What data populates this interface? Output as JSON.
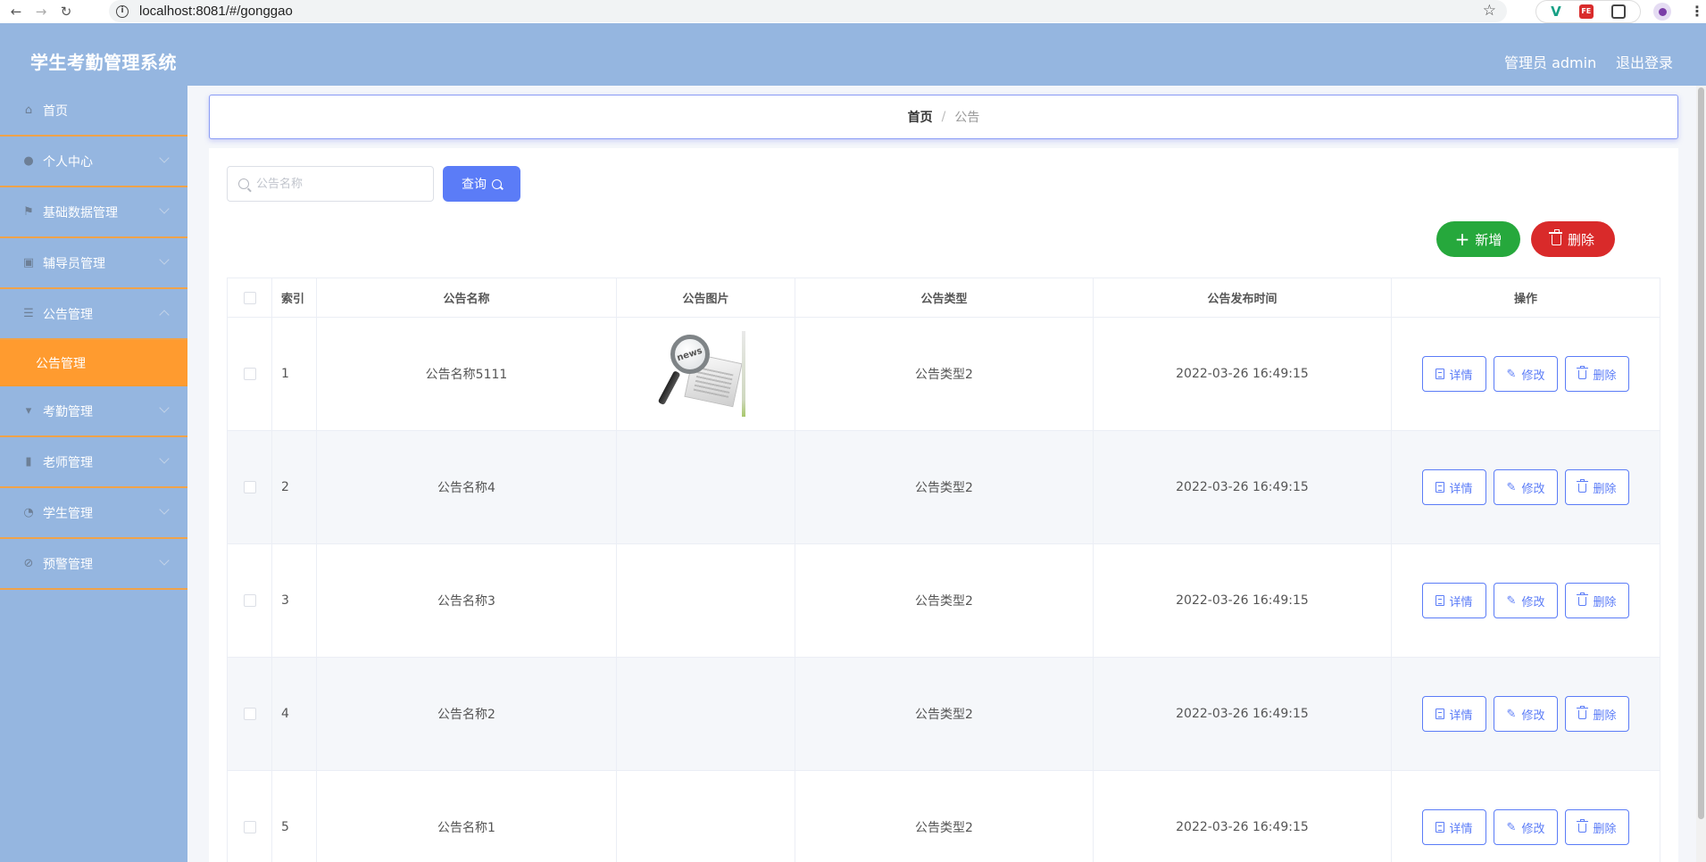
{
  "browser": {
    "url": "localhost:8081/#/gonggao"
  },
  "header": {
    "title": "学生考勤管理系统",
    "user": "管理员 admin",
    "logout": "退出登录"
  },
  "sidebar": {
    "items": [
      {
        "label": "首页",
        "icon": "home-icon"
      },
      {
        "label": "个人中心",
        "icon": "user-icon"
      },
      {
        "label": "基础数据管理",
        "icon": "flag-icon"
      },
      {
        "label": "辅导员管理",
        "icon": "chart-icon"
      },
      {
        "label": "公告管理",
        "icon": "menu-icon"
      },
      {
        "label": "考勤管理",
        "icon": "brush-icon"
      },
      {
        "label": "老师管理",
        "icon": "bar-chart-icon"
      },
      {
        "label": "学生管理",
        "icon": "gauge-icon"
      },
      {
        "label": "预警管理",
        "icon": "bell-off-icon"
      }
    ],
    "active_sub": "公告管理"
  },
  "breadcrumb": {
    "home": "首页",
    "sep": "/",
    "current": "公告"
  },
  "search": {
    "placeholder": "公告名称",
    "value": "",
    "button": "查询"
  },
  "actions": {
    "add": "新增",
    "delete": "删除"
  },
  "table": {
    "columns": [
      "索引",
      "公告名称",
      "公告图片",
      "公告类型",
      "公告发布时间",
      "操作"
    ],
    "rows": [
      {
        "idx": "1",
        "name": "公告名称5111",
        "has_image": true,
        "image_text": "news",
        "type": "公告类型2",
        "time": "2022-03-26 16:49:15"
      },
      {
        "idx": "2",
        "name": "公告名称4",
        "has_image": false,
        "type": "公告类型2",
        "time": "2022-03-26 16:49:15"
      },
      {
        "idx": "3",
        "name": "公告名称3",
        "has_image": false,
        "type": "公告类型2",
        "time": "2022-03-26 16:49:15"
      },
      {
        "idx": "4",
        "name": "公告名称2",
        "has_image": false,
        "type": "公告类型2",
        "time": "2022-03-26 16:49:15"
      },
      {
        "idx": "5",
        "name": "公告名称1",
        "has_image": false,
        "type": "公告类型2",
        "time": "2022-03-26 16:49:15"
      }
    ],
    "ops": {
      "detail": "详情",
      "edit": "修改",
      "delete": "删除"
    }
  },
  "colors": {
    "header_bg": "#95b6e0",
    "active_menu": "#ff9b2f",
    "primary": "#5b7cf7",
    "success": "#26a83c",
    "danger": "#d92a2a"
  }
}
